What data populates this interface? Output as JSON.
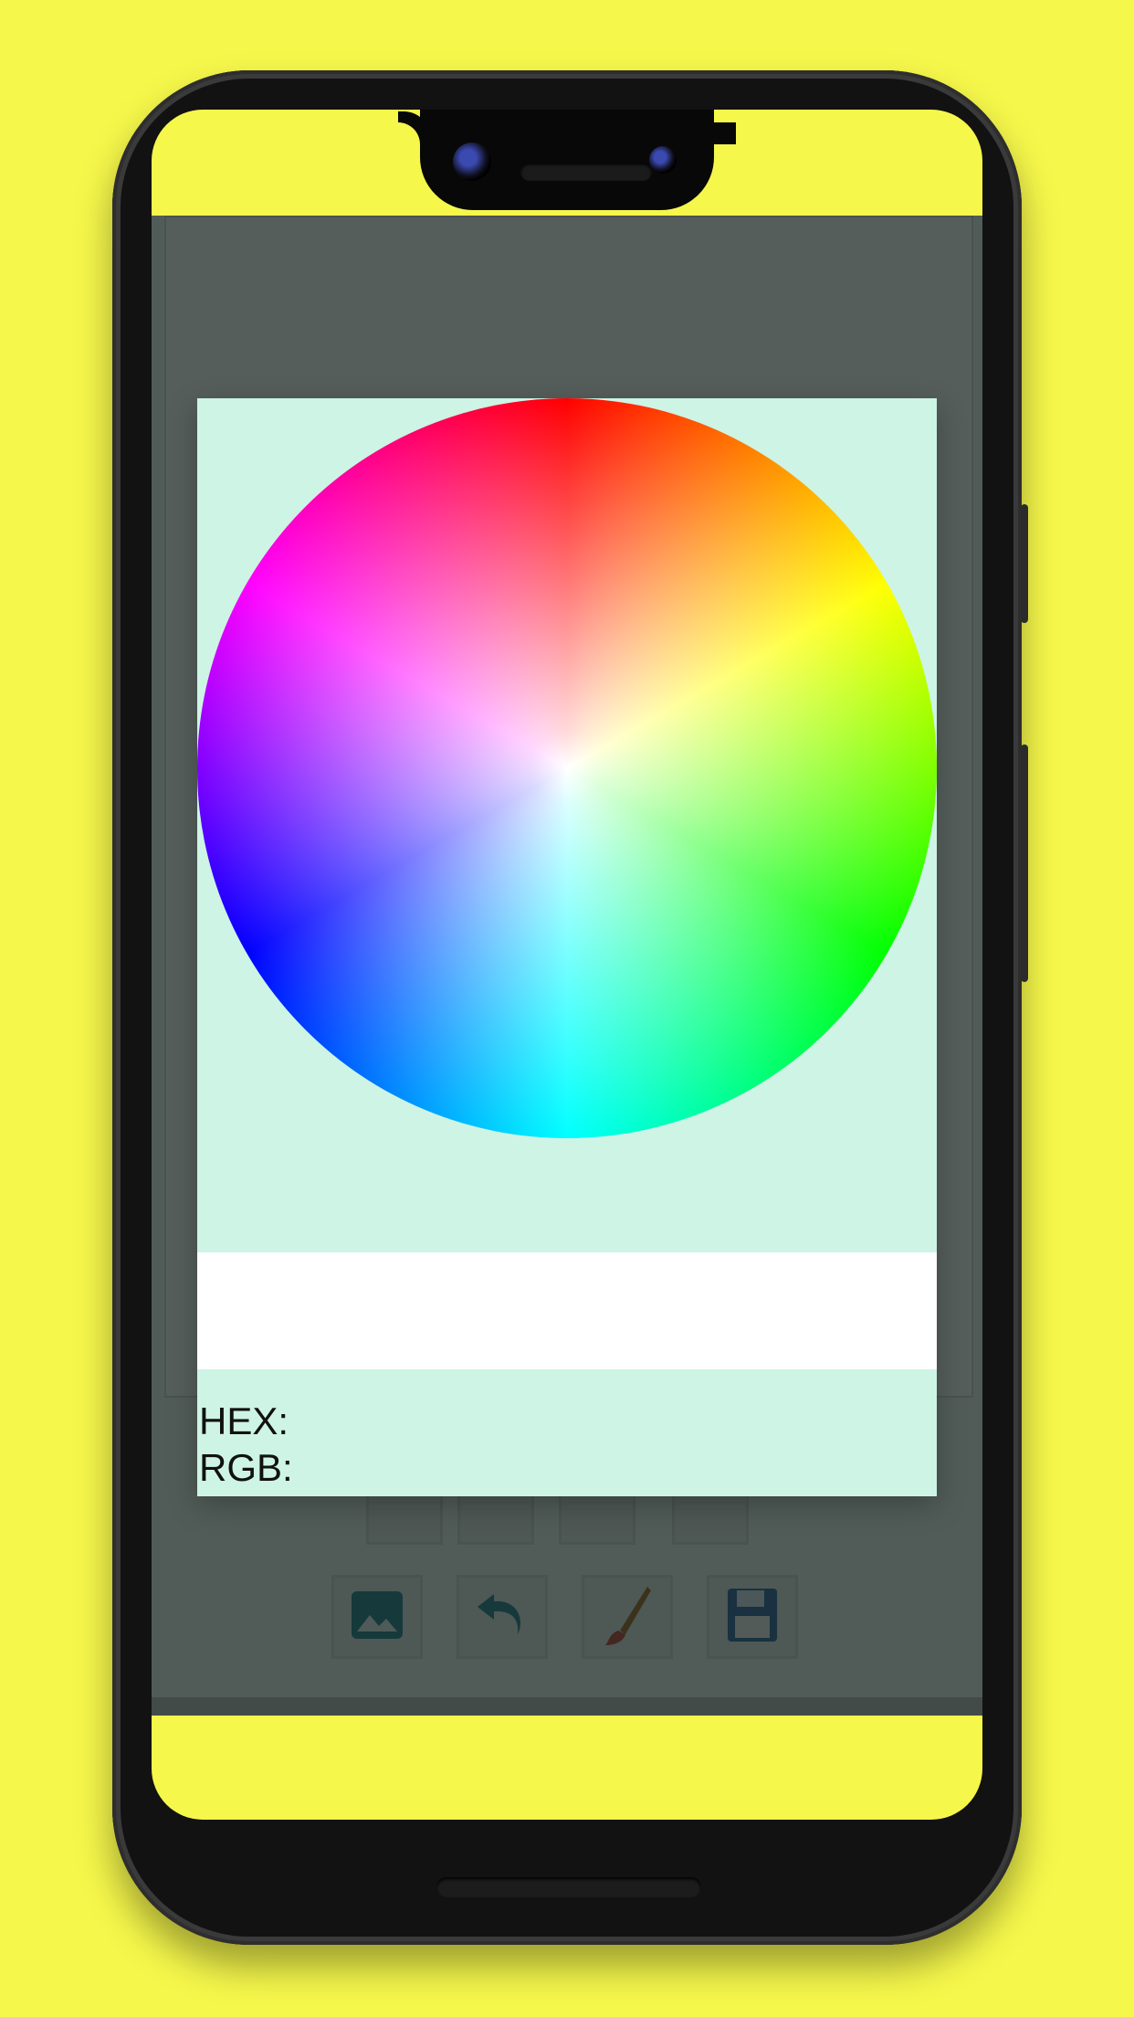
{
  "colors": {
    "background": "#f5f74b",
    "dialog": "#cdf4e4",
    "preview": "#ffffff"
  },
  "dialog": {
    "hex_label": "HEX:",
    "rgb_label": "RGB:",
    "wheel_icon": "color-wheel"
  },
  "toolbar": {
    "buttons": [
      {
        "icon": "image-icon"
      },
      {
        "icon": "undo-icon"
      },
      {
        "icon": "brush-icon"
      },
      {
        "icon": "save-icon"
      }
    ]
  }
}
